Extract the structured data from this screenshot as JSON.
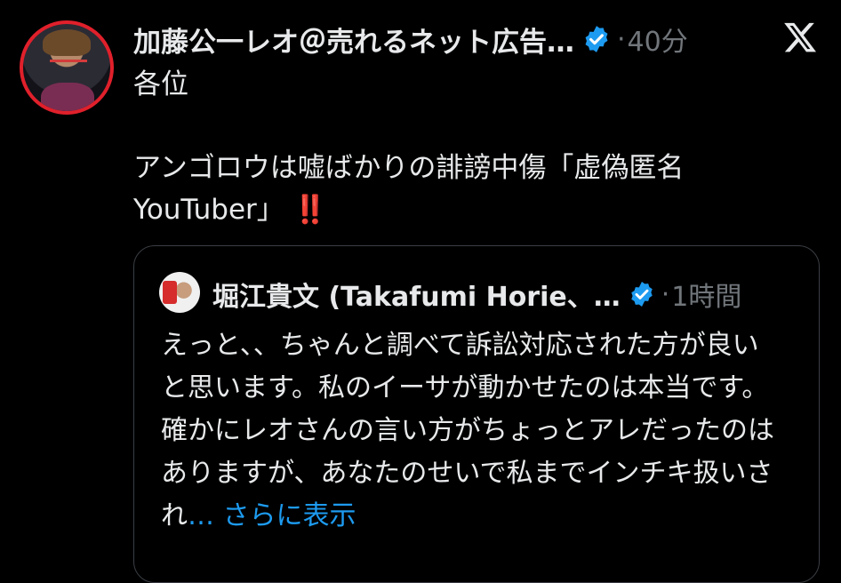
{
  "tweet": {
    "author_name": "加藤公一レオ＠売れるネット広告…",
    "timestamp": "40分",
    "separator": "·",
    "body_lines": [
      "各位",
      "",
      "アンゴロウは嘘ばかりの誹謗中傷「虚偽匿名",
      "YouTuber」"
    ],
    "emphasis": "‼️"
  },
  "quoted_tweet": {
    "author_name": "堀江貴文 (Takafumi Horie、…",
    "timestamp": "1時間",
    "separator": "·",
    "text": "えっと、、ちゃんと調べて訴訟対応された方が良いと思います。私のイーサが動かせたのは本当です。確かにレオさんの言い方がちょっとアレだったのはありますが、あなたのせいで私までインチキ扱いされ",
    "more_label": "… さらに表示"
  },
  "icons": {
    "verified": "verified-badge-icon",
    "logo": "x-logo-icon"
  },
  "colors": {
    "background": "#000000",
    "text": "#e7e9ea",
    "muted": "#71767b",
    "link": "#1d9bf0",
    "verified": "#1d9bf0",
    "avatar_ring": "#e0202b"
  }
}
